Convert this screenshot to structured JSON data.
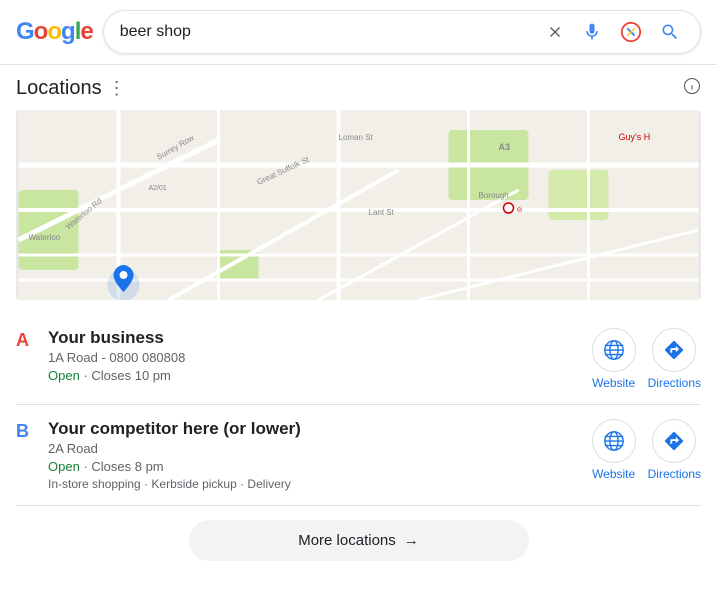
{
  "search": {
    "query": "beer shop",
    "placeholder": "beer shop"
  },
  "header": {
    "title": "Locations",
    "info_label": "ⓘ"
  },
  "locations": [
    {
      "label": "A",
      "name": "Your business",
      "address": "1A Road - 0800 080808",
      "status_open": "Open",
      "status_close": "Closes 10 pm",
      "features": "",
      "website_label": "Website",
      "directions_label": "Directions"
    },
    {
      "label": "B",
      "name": "Your competitor here (or lower)",
      "address": "2A Road",
      "status_open": "Open",
      "status_close": "Closes 8 pm",
      "features": "In-store shopping · Kerbside pickup · Delivery",
      "website_label": "Website",
      "directions_label": "Directions"
    }
  ],
  "more_locations_label": "More locations",
  "arrow": "→"
}
